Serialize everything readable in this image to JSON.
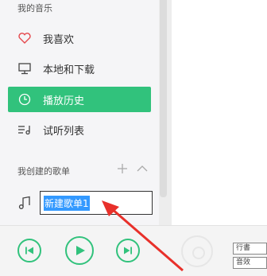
{
  "sidebar": {
    "my_music_title": "我的音乐",
    "items": [
      {
        "label": "我喜欢",
        "icon": "heart-icon",
        "active": false
      },
      {
        "label": "本地和下载",
        "icon": "monitor-icon",
        "active": false
      },
      {
        "label": "播放历史",
        "icon": "clock-icon",
        "active": true
      },
      {
        "label": "试听列表",
        "icon": "list-music-icon",
        "active": false
      }
    ],
    "created_playlists_title": "我创建的歌单",
    "new_playlist": {
      "icon": "music-note-icon",
      "value": "新建歌单1"
    }
  },
  "player": {
    "buttons": [
      "prev-icon",
      "play-icon",
      "next-icon"
    ],
    "tags": [
      "行書",
      "音效"
    ]
  },
  "colors": {
    "accent": "#31c27c",
    "heart": "#e5484d",
    "selection": "#3399ff",
    "arrow": "#e8302a"
  }
}
